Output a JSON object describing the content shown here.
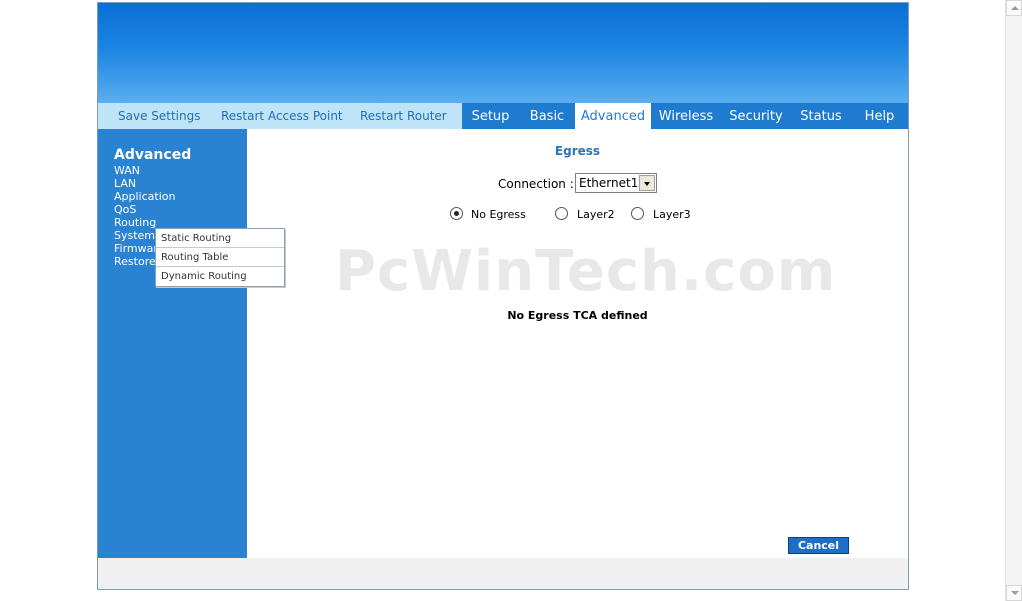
{
  "utility_links": [
    {
      "label": "Save Settings"
    },
    {
      "label": "Restart Access Point"
    },
    {
      "label": "Restart Router"
    }
  ],
  "tabs": [
    {
      "label": "Setup"
    },
    {
      "label": "Basic"
    },
    {
      "label": "Advanced",
      "active": true
    },
    {
      "label": "Wireless"
    },
    {
      "label": "Security"
    },
    {
      "label": "Status"
    },
    {
      "label": "Help"
    }
  ],
  "sidebar": {
    "title": "Advanced",
    "items": [
      {
        "label": "WAN"
      },
      {
        "label": "LAN"
      },
      {
        "label": "Application"
      },
      {
        "label": "QoS"
      },
      {
        "label": "Routing"
      },
      {
        "label": "System"
      },
      {
        "label": "Firmware"
      },
      {
        "label": "Restore"
      }
    ]
  },
  "flyout": {
    "items": [
      {
        "label": "Static Routing"
      },
      {
        "label": "Routing Table"
      },
      {
        "label": "Dynamic Routing"
      }
    ]
  },
  "content": {
    "heading": "Egress",
    "connection_label": "Connection :",
    "connection_value": "Ethernet1",
    "radios": [
      {
        "label": "No Egress",
        "checked": true
      },
      {
        "label": "Layer2",
        "checked": false
      },
      {
        "label": "Layer3",
        "checked": false
      }
    ],
    "empty_message": "No Egress TCA defined",
    "cancel_label": "Cancel"
  },
  "watermark": "PcWinTech.com",
  "colors": {
    "banner": "#1b84e1",
    "tab_bar": "#1f7bd0",
    "sidebar": "#2a82d2",
    "utility_bar": "#bfe3f7",
    "heading": "#2a74b8",
    "button": "#1e6ec3"
  }
}
